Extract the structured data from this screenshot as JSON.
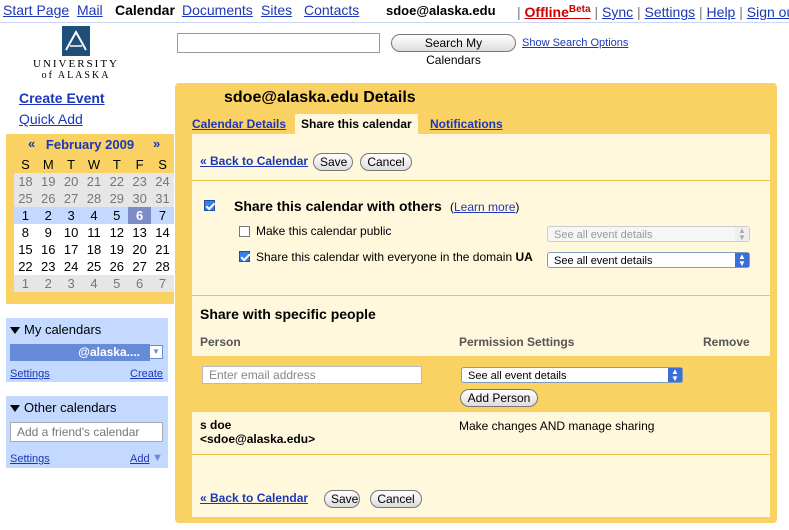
{
  "topnav": {
    "start_page": "Start Page",
    "mail": "Mail",
    "calendar": "Calendar",
    "documents": "Documents",
    "sites": "Sites",
    "contacts": "Contacts",
    "email": "sdoe@alaska.edu",
    "offline": "Offline",
    "beta": "Beta",
    "sync": "Sync",
    "settings": "Settings",
    "help": "Help",
    "sign_out": "Sign out",
    "sep": "|"
  },
  "logo": {
    "line1": "UNIVERSITY",
    "line2": "of ALASKA"
  },
  "search": {
    "value": "",
    "button": "Search My Calendars",
    "options_link": "Show Search Options"
  },
  "left": {
    "create_event": "Create Event",
    "quick_add": "Quick Add"
  },
  "minical": {
    "prev": "«",
    "next": "»",
    "month": "February 2009",
    "dow": [
      "S",
      "M",
      "T",
      "W",
      "T",
      "F",
      "S"
    ],
    "weeks": [
      [
        "18",
        "19",
        "20",
        "21",
        "22",
        "23",
        "24"
      ],
      [
        "25",
        "26",
        "27",
        "28",
        "29",
        "30",
        "31"
      ],
      [
        "1",
        "2",
        "3",
        "4",
        "5",
        "6",
        "7"
      ],
      [
        "8",
        "9",
        "10",
        "11",
        "12",
        "13",
        "14"
      ],
      [
        "15",
        "16",
        "17",
        "18",
        "19",
        "20",
        "21"
      ],
      [
        "22",
        "23",
        "24",
        "25",
        "26",
        "27",
        "28"
      ],
      [
        "1",
        "2",
        "3",
        "4",
        "5",
        "6",
        "7"
      ]
    ]
  },
  "my_calendars": {
    "title": "My calendars",
    "item": "@alaska....",
    "settings": "Settings",
    "create": "Create"
  },
  "other_calendars": {
    "title": "Other calendars",
    "placeholder": "Add a friend's calendar",
    "settings": "Settings",
    "add": "Add"
  },
  "main": {
    "title": "sdoe@alaska.edu Details",
    "tabs": [
      "Calendar Details",
      "Share this calendar",
      "Notifications"
    ],
    "back": "« Back to Calendar",
    "save": "Save",
    "cancel": "Cancel",
    "share_others": "Share this calendar with others",
    "learn_more": "Learn more",
    "paren_open": "(",
    "paren_close": ")",
    "make_public": "Make this calendar public",
    "public_select": "See all event details",
    "domain_share": "Share this calendar with everyone in the domain",
    "domain_name": "UA",
    "domain_select": "See all event details",
    "specific_title": "Share with specific people",
    "col_person": "Person",
    "col_permission": "Permission Settings",
    "col_remove": "Remove",
    "email_placeholder": "Enter email address",
    "perm_select": "See all event details",
    "add_person": "Add Person",
    "person_name": "s  doe",
    "person_email": "<sdoe@alaska.edu>",
    "person_perm": "Make changes AND manage sharing"
  },
  "colors": {
    "accent": "#fad163",
    "panel": "#c3d9ff",
    "link": "#1c37b7"
  }
}
